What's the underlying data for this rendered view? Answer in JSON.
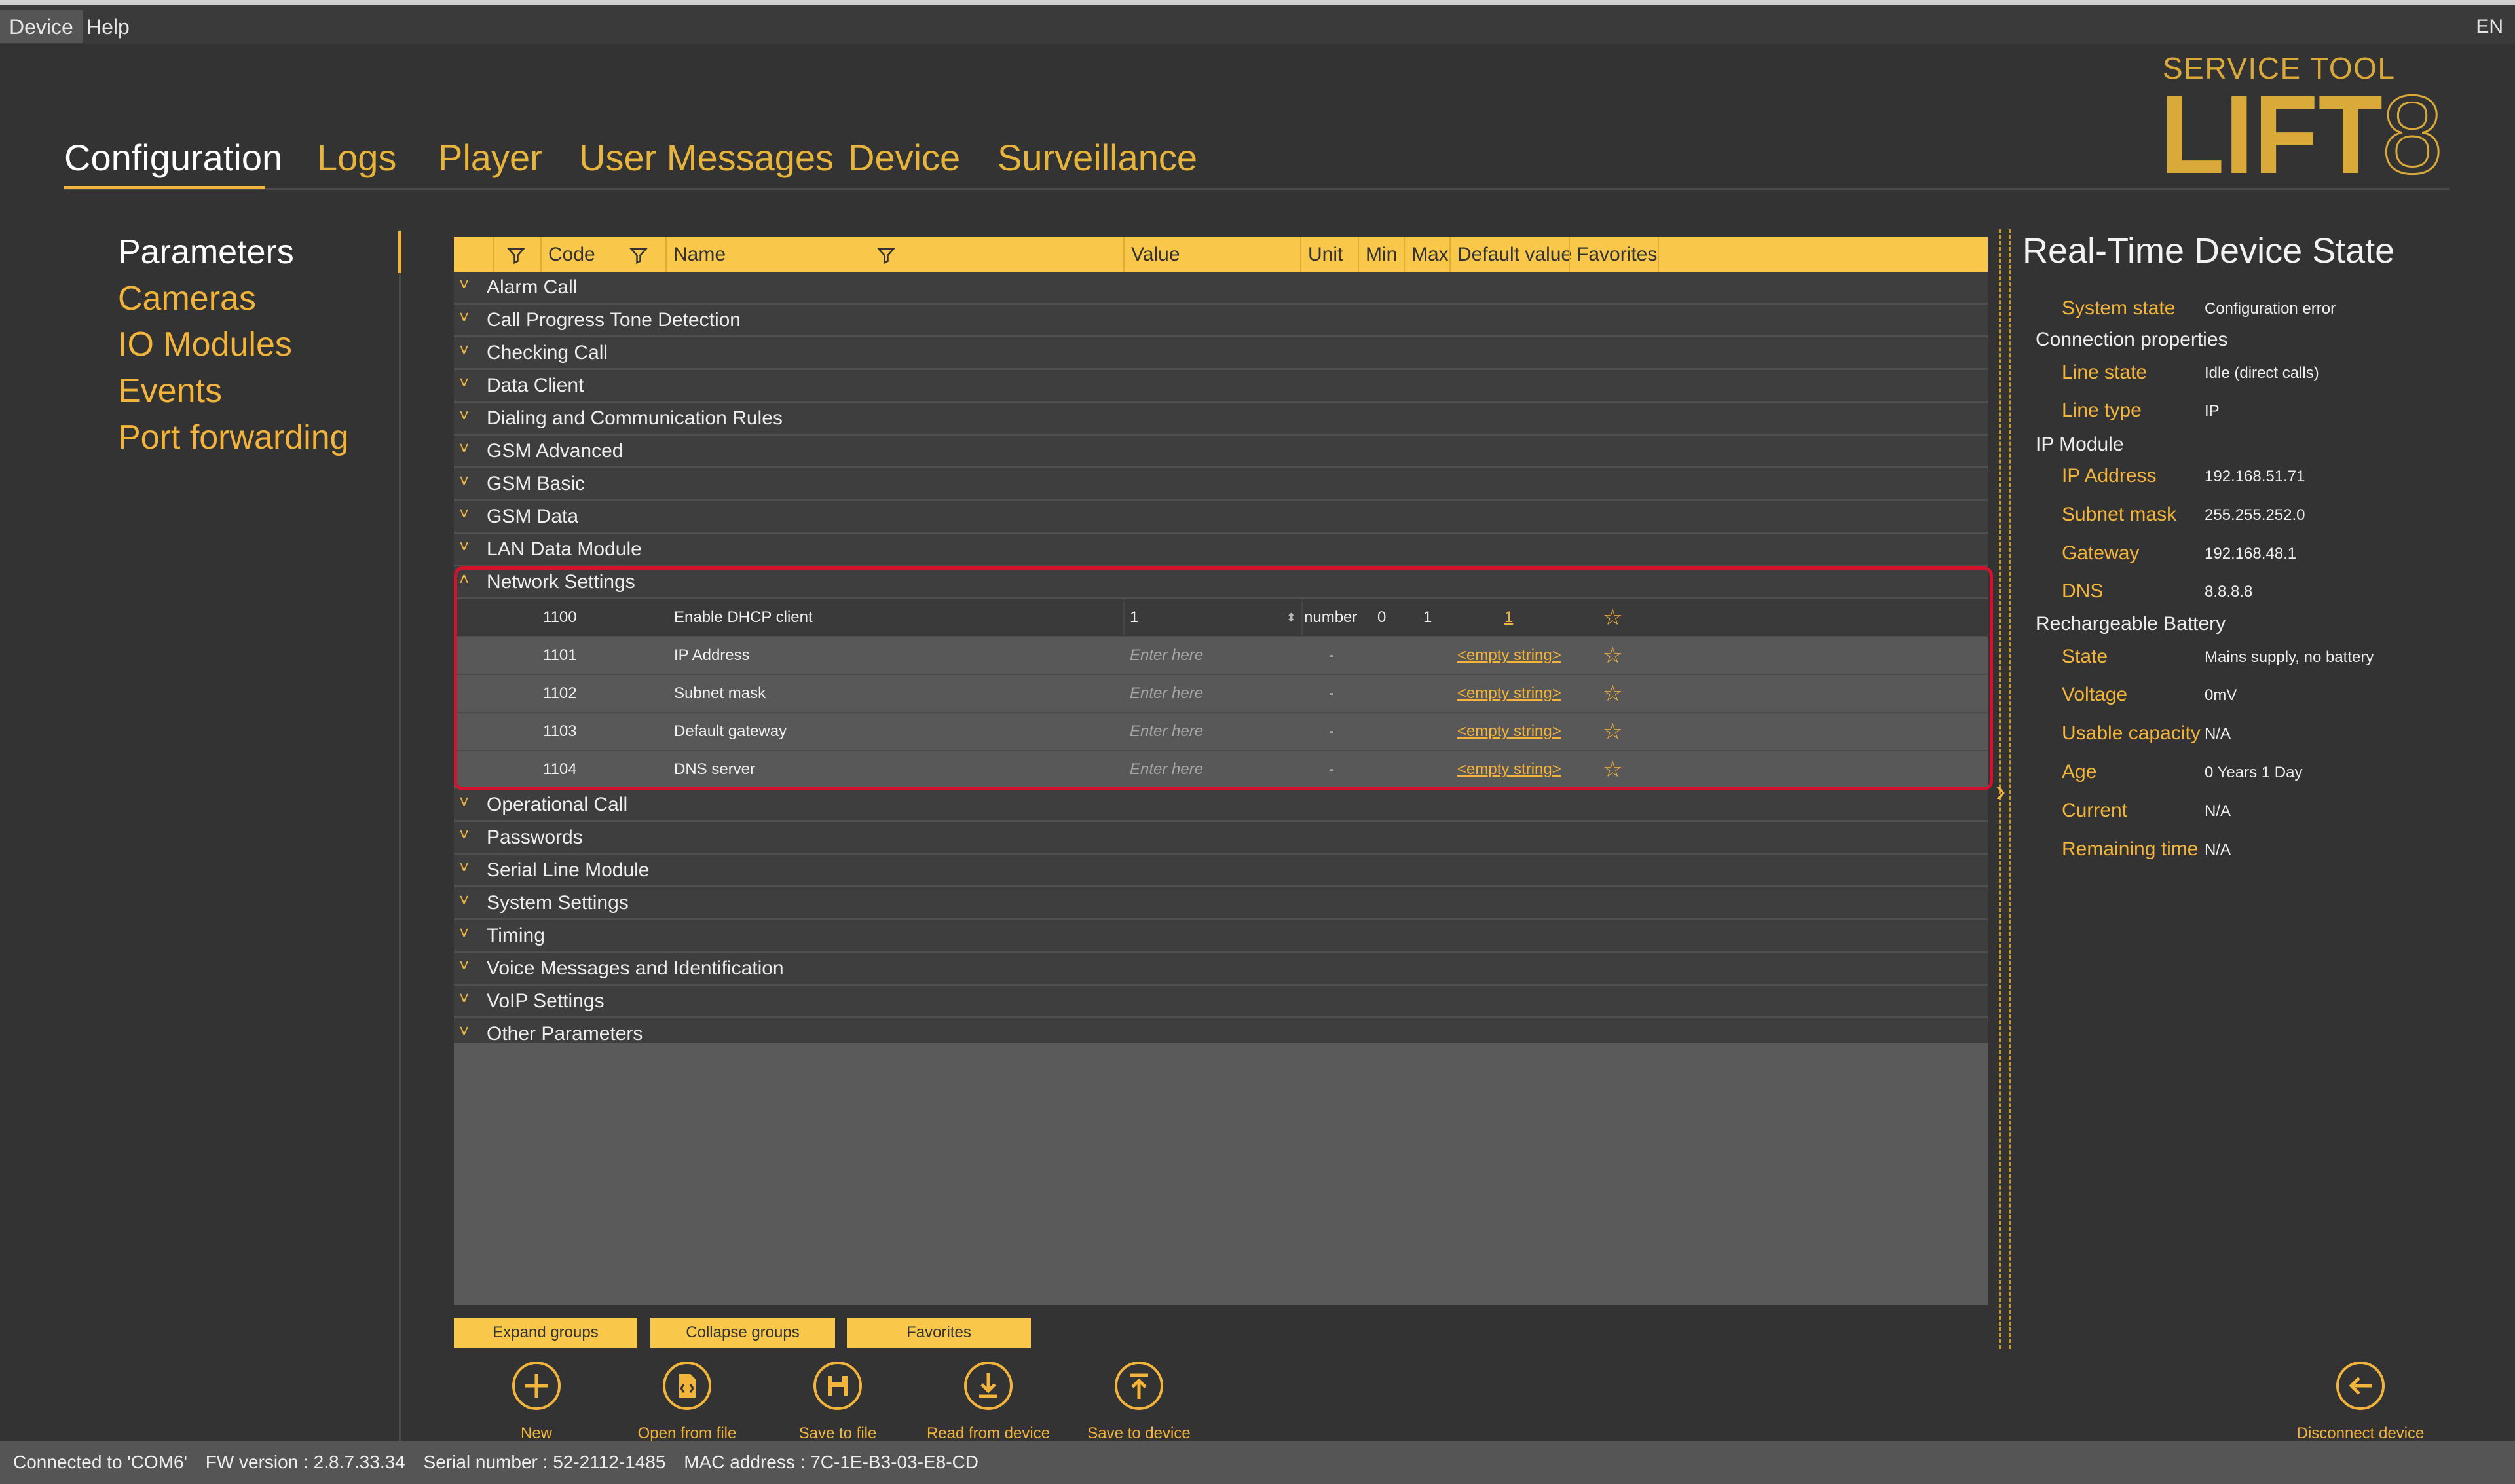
{
  "menubar": {
    "device": "Device",
    "help": "Help",
    "lang": "EN"
  },
  "tabs": [
    "Configuration",
    "Logs",
    "Player",
    "User Messages",
    "Device",
    "Surveillance"
  ],
  "logo": {
    "subtitle": "SERVICE TOOL",
    "name": "LIFT8"
  },
  "sidebar": [
    "Parameters",
    "Cameras",
    "IO Modules",
    "Events",
    "Port forwarding"
  ],
  "table": {
    "columns": {
      "code": "Code",
      "name": "Name",
      "value": "Value",
      "unit": "Unit",
      "min": "Min",
      "max": "Max",
      "default": "Default value",
      "favorites": "Favorites"
    },
    "groups_before": [
      "Alarm Call",
      "Call Progress Tone Detection",
      "Checking Call",
      "Data Client",
      "Dialing and Communication Rules",
      "GSM Advanced",
      "GSM Basic",
      "GSM Data",
      "LAN Data Module"
    ],
    "expanded_group": "Network Settings",
    "rows": [
      {
        "code": "1100",
        "name": "Enable DHCP client",
        "value": "1",
        "unit": "number",
        "min": "0",
        "max": "1",
        "default": "1"
      },
      {
        "code": "1101",
        "name": "IP Address",
        "placeholder": "Enter here",
        "unit": "-",
        "default": "<empty string>"
      },
      {
        "code": "1102",
        "name": "Subnet mask",
        "placeholder": "Enter here",
        "unit": "-",
        "default": "<empty string>"
      },
      {
        "code": "1103",
        "name": "Default gateway",
        "placeholder": "Enter here",
        "unit": "-",
        "default": "<empty string>"
      },
      {
        "code": "1104",
        "name": "DNS server",
        "placeholder": "Enter here",
        "unit": "-",
        "default": "<empty string>"
      }
    ],
    "groups_after": [
      "Operational Call",
      "Passwords",
      "Serial Line Module",
      "System Settings",
      "Timing",
      "Voice Messages and Identification",
      "VoIP Settings",
      "Other Parameters"
    ]
  },
  "buttons": {
    "expand": "Expand groups",
    "collapse": "Collapse groups",
    "favorites": "Favorites"
  },
  "actions": {
    "new": "New",
    "open": "Open from file",
    "save_file": "Save to file",
    "read": "Read from device",
    "save_device": "Save to device",
    "disconnect": "Disconnect device"
  },
  "realtime": {
    "title": "Real-Time Device State",
    "system_state_label": "System state",
    "system_state": "Configuration error",
    "connection": "Connection properties",
    "line_state_label": "Line state",
    "line_state": "Idle (direct calls)",
    "line_type_label": "Line type",
    "line_type": "IP",
    "ip_module": "IP Module",
    "ip_label": "IP Address",
    "ip": "192.168.51.71",
    "subnet_label": "Subnet mask",
    "subnet": "255.255.252.0",
    "gateway_label": "Gateway",
    "gateway": "192.168.48.1",
    "dns_label": "DNS",
    "dns": "8.8.8.8",
    "battery": "Rechargeable Battery",
    "state_label": "State",
    "state": "Mains supply, no battery",
    "voltage_label": "Voltage",
    "voltage": "0mV",
    "capacity_label": "Usable capacity",
    "capacity": "N/A",
    "age_label": "Age",
    "age": "0 Years 1 Day",
    "current_label": "Current",
    "current": "N/A",
    "remaining_label": "Remaining time",
    "remaining": "N/A"
  },
  "status": {
    "connected": "Connected to 'COM6'",
    "fw": "FW version : 2.8.7.33.34",
    "serial": "Serial number : 52-2112-1485",
    "mac": "MAC address : 7C-1E-B3-03-E8-CD"
  },
  "colors": {
    "accent": "#f2b43b",
    "header": "#f9c74a",
    "highlight": "#d4122e",
    "background": "#333333"
  }
}
